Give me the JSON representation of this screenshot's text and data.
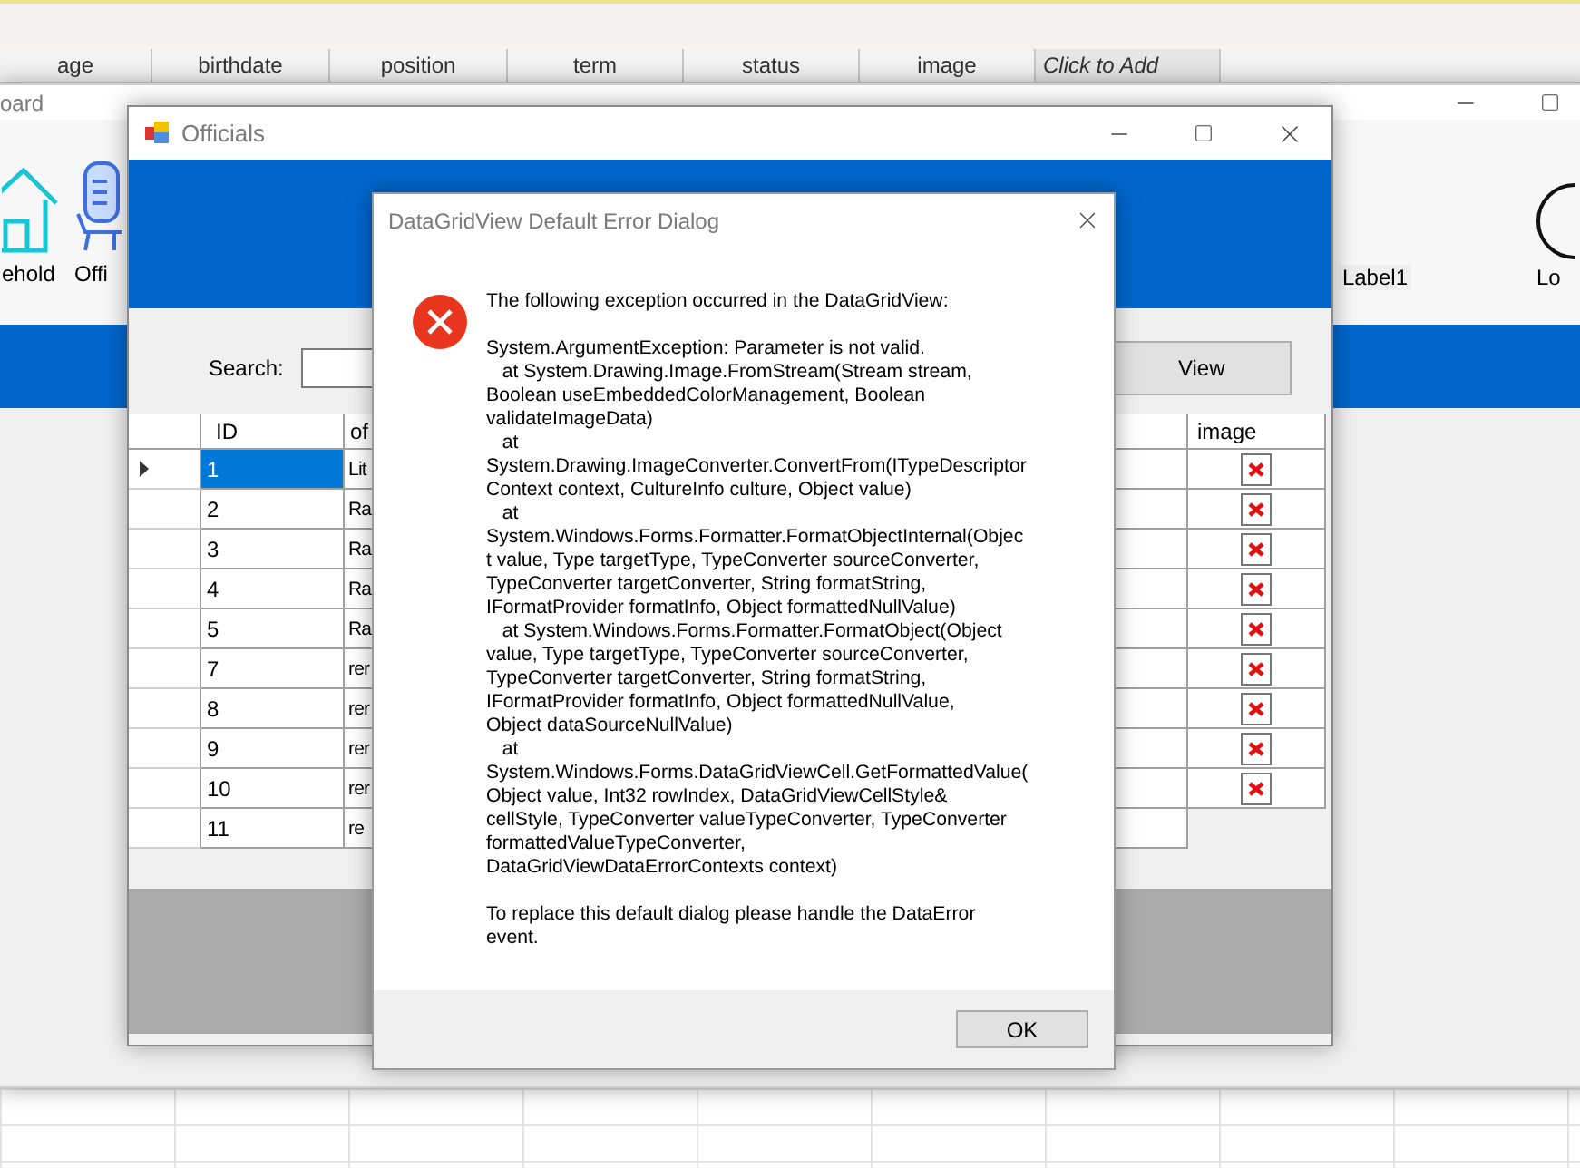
{
  "background_sheet": {
    "columns": [
      {
        "label": "age",
        "italic": false
      },
      {
        "label": "birthdate",
        "italic": false
      },
      {
        "label": "position",
        "italic": false
      },
      {
        "label": "term",
        "italic": false
      },
      {
        "label": "status",
        "italic": false
      },
      {
        "label": "image",
        "italic": false
      },
      {
        "label": "Click to Add",
        "italic": true
      }
    ]
  },
  "dashboard_window": {
    "title": "oard",
    "nav": [
      {
        "label": "ehold",
        "kind": "house"
      },
      {
        "label": "Offi",
        "kind": "officials"
      }
    ],
    "status_label": "Label1",
    "logout": {
      "label": "Lo"
    }
  },
  "officials_window": {
    "title": "Officials",
    "search": {
      "label": "Search:"
    },
    "view_button": "View",
    "table": {
      "columns": [
        "ID",
        "of",
        "image"
      ],
      "rows": [
        {
          "id": "1",
          "official": "Lit",
          "image_error": true,
          "selected": true
        },
        {
          "id": "2",
          "official": "Ra",
          "image_error": true,
          "selected": false
        },
        {
          "id": "3",
          "official": "Ra",
          "image_error": true,
          "selected": false
        },
        {
          "id": "4",
          "official": "Ra",
          "image_error": true,
          "selected": false
        },
        {
          "id": "5",
          "official": "Ra",
          "image_error": true,
          "selected": false
        },
        {
          "id": "7",
          "official": "rer",
          "image_error": true,
          "selected": false
        },
        {
          "id": "8",
          "official": "rer",
          "image_error": true,
          "selected": false
        },
        {
          "id": "9",
          "official": "rer",
          "image_error": true,
          "selected": false
        },
        {
          "id": "10",
          "official": "rer",
          "image_error": true,
          "selected": false
        },
        {
          "id": "11",
          "official": "re",
          "image_error": false,
          "selected": false
        }
      ]
    }
  },
  "error_dialog": {
    "title": "DataGridView Default Error Dialog",
    "message": [
      "The following exception occurred in the DataGridView:",
      "System.ArgumentException: Parameter is not valid.\n   at System.Drawing.Image.FromStream(Stream stream,\nBoolean useEmbeddedColorManagement, Boolean\nvalidateImageData)\n   at\nSystem.Drawing.ImageConverter.ConvertFrom(ITypeDescriptor\nContext context, CultureInfo culture, Object value)\n   at\nSystem.Windows.Forms.Formatter.FormatObjectInternal(Objec\nt value, Type targetType, TypeConverter sourceConverter,\nTypeConverter targetConverter, String formatString,\nIFormatProvider formatInfo, Object formattedNullValue)\n   at System.Windows.Forms.Formatter.FormatObject(Object\nvalue, Type targetType, TypeConverter sourceConverter,\nTypeConverter targetConverter, String formatString,\nIFormatProvider formatInfo, Object formattedNullValue,\nObject dataSourceNullValue)\n   at\nSystem.Windows.Forms.DataGridViewCell.GetFormattedValue(\nObject value, Int32 rowIndex, DataGridViewCellStyle&\ncellStyle, TypeConverter valueTypeConverter, TypeConverter\nformattedValueTypeConverter,\nDataGridViewDataErrorContexts context)",
      "To replace this default dialog please handle the DataError\nevent."
    ],
    "ok_button": "OK"
  }
}
